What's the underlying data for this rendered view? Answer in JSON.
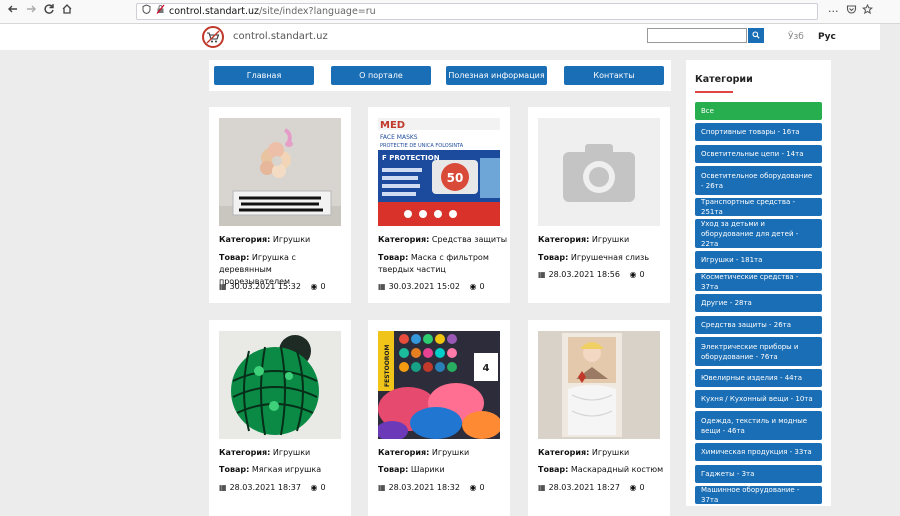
{
  "browser": {
    "url_host": "control.standart.uz",
    "url_path": "/site/index?language=ru",
    "back_icon": "arrow-left-icon",
    "forward_icon": "arrow-right-icon",
    "reload_icon": "reload-icon",
    "home_icon": "home-icon",
    "more_label": "···"
  },
  "header": {
    "site_name": "control.standart.uz",
    "search_placeholder": "",
    "lang_uz": "Ўзб",
    "lang_ru": "Рус"
  },
  "nav": {
    "items": [
      "Главная",
      "О портале",
      "Полезная информация",
      "Контакты"
    ]
  },
  "products": [
    {
      "category_label": "Категория:",
      "category": "Игрушки",
      "product_label": "Товар:",
      "name": "Игрушка с деревянным прорезывателем",
      "date": "30.03.2021 15:32",
      "views": "0"
    },
    {
      "category_label": "Категория:",
      "category": "Средства защиты",
      "product_label": "Товар:",
      "name": "Маска с фильтром твердых частиц",
      "date": "30.03.2021 15:02",
      "views": "0"
    },
    {
      "category_label": "Категория:",
      "category": "Игрушки",
      "product_label": "Товар:",
      "name": "Игрушечная слизь",
      "date": "28.03.2021 18:56",
      "views": "0"
    },
    {
      "category_label": "Категория:",
      "category": "Игрушки",
      "product_label": "Товар:",
      "name": "Мягкая игрушка",
      "date": "28.03.2021 18:37",
      "views": "0"
    },
    {
      "category_label": "Категория:",
      "category": "Игрушки",
      "product_label": "Товар:",
      "name": "Шарики",
      "date": "28.03.2021 18:32",
      "views": "0"
    },
    {
      "category_label": "Категория:",
      "category": "Игрушки",
      "product_label": "Товар:",
      "name": "Маскарадный костюм",
      "date": "28.03.2021 18:27",
      "views": "0"
    }
  ],
  "mask_image_text": {
    "brand": "MED",
    "line1": "FACE MASKS",
    "line2": "PROTECTIE DE UNICA FOLOSINTA",
    "line3": "F PROTECTION",
    "count": "50"
  },
  "balloon_image_text": {
    "brand": "FESTOOROM",
    "number": "4"
  },
  "sidebar": {
    "title": "Категории",
    "categories": [
      "Все",
      "Спортивные товары - 16та",
      "Осветительные цепи - 14та",
      "Осветительное оборудование - 26та",
      "Транспортные средства - 251та",
      "Уход за детьми и оборудование для детей - 22та",
      "Игрушки - 181та",
      "Косметические средства - 37та",
      "Другие - 28та",
      "Средства защиты - 26та",
      "Электрические приборы и оборудование - 76та",
      "Ювелирные изделия - 44та",
      "Кухня / Кухонный вещи - 10та",
      "Одежда, текстиль и модные вещи - 46та",
      "Химическая продукция - 33та",
      "Гаджеты - 3та",
      "Машинное оборудование - 37та"
    ]
  },
  "colors": {
    "primary": "#1a6eb5",
    "active": "#27ae4f",
    "accent": "#e04545"
  }
}
